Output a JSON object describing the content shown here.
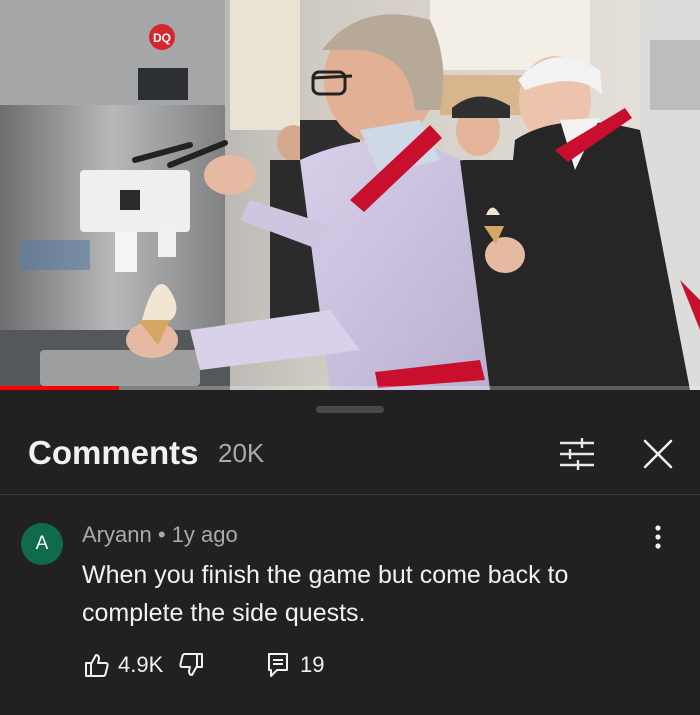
{
  "video": {
    "store_logo": "DQ",
    "progress_fraction": 0.17
  },
  "comments_panel": {
    "title": "Comments",
    "count": "20K",
    "sort_icon": "sort-filter-icon",
    "close_icon": "close-icon"
  },
  "comment": {
    "avatar_letter": "A",
    "avatar_color": "#0e6b4c",
    "author": "Aryann",
    "separator": "•",
    "time": "1y ago",
    "text": "When you finish the game but come back to complete the side quests.",
    "likes": "4.9K",
    "replies": "19",
    "like_icon": "thumbs-up-icon",
    "dislike_icon": "thumbs-down-icon",
    "reply_icon": "comment-icon",
    "more_icon": "more-vertical-icon"
  },
  "colors": {
    "background": "#212121",
    "progress": "#ff0000",
    "apron": "#c8102e"
  }
}
